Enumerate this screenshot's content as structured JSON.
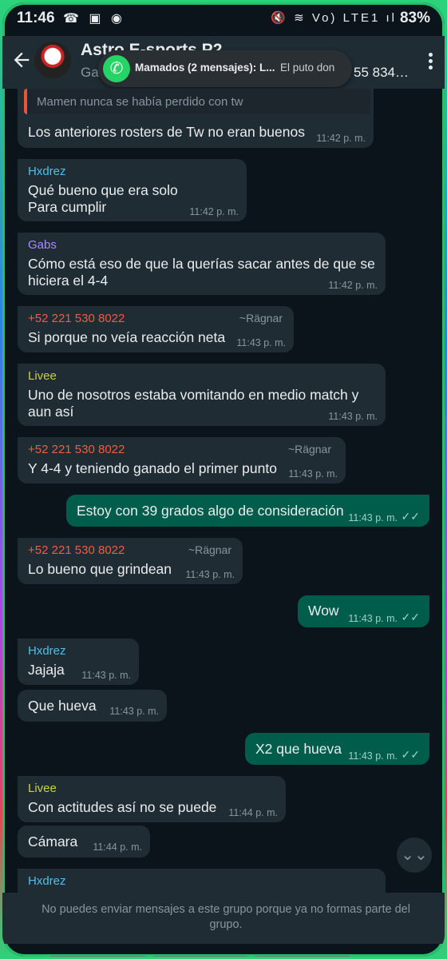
{
  "status": {
    "time": "11:46",
    "left_icons": "☎ ▣ ◉",
    "right_icons": "🔇 ≋ Vo) LTE1 ıl",
    "battery": "83%"
  },
  "header": {
    "title": "Astro E-sports P2",
    "subtitle": "Ga",
    "subtitle_end": "55 834…"
  },
  "notification": {
    "title": "Mamados (2 mensajes): L...",
    "text": "El puto don"
  },
  "quote": {
    "text": "Mamen nunca se había perdido con tw"
  },
  "messages": [
    {
      "text": "Los anteriores rosters de Tw no eran buenos",
      "time": "11:42 p. m."
    },
    {
      "sender": "Hxdrez",
      "text": "Qué bueno que era solo\nPara cumplir",
      "time": "11:42 p. m."
    },
    {
      "sender": "Gabs",
      "text": "Cómo está eso de que la querías sacar antes de que se hiciera el 4-4",
      "time": "11:42 p. m."
    },
    {
      "sender": "+52 221 530 8022",
      "alias": "~Rägnar",
      "text": "Si porque no veía reacción neta",
      "time": "11:43 p. m."
    },
    {
      "sender": "Livee",
      "text": "Uno de nosotros estaba vomitando en medio match y aun así",
      "time": "11:43 p. m."
    },
    {
      "sender": "+52 221 530 8022",
      "alias": "~Rägnar",
      "text": "Y 4-4 y teniendo ganado el primer punto",
      "time": "11:43 p. m."
    },
    {
      "text": "Estoy con 39 grados algo de consideración",
      "time": "11:43 p. m.",
      "outgoing": true
    },
    {
      "sender": "+52 221 530 8022",
      "alias": "~Rägnar",
      "text": "Lo bueno que grindean",
      "time": "11:43 p. m."
    },
    {
      "text": "Wow",
      "time": "11:43 p. m.",
      "outgoing": true
    },
    {
      "sender": "Hxdrez",
      "text": "Jajaja",
      "time": "11:43 p. m."
    },
    {
      "text": "Que hueva",
      "time": "11:43 p. m."
    },
    {
      "text": "X2 que hueva",
      "time": "11:43 p. m.",
      "outgoing": true
    },
    {
      "sender": "Livee",
      "text": "Con actitudes así no se puede",
      "time": "11:44 p. m."
    },
    {
      "text": "Cámara",
      "time": "11:44 p. m."
    },
    {
      "sender": "Hxdrez"
    }
  ],
  "colors": {
    "hxdrez": "#53bdeb",
    "gabs": "#a78bfa",
    "ragnar": "#f15c3f",
    "livee": "#c8d33d"
  },
  "scroll_button_icon": "⌄⌄",
  "footer": {
    "text": "No puedes enviar mensajes a este grupo porque ya no formas parte del grupo."
  }
}
